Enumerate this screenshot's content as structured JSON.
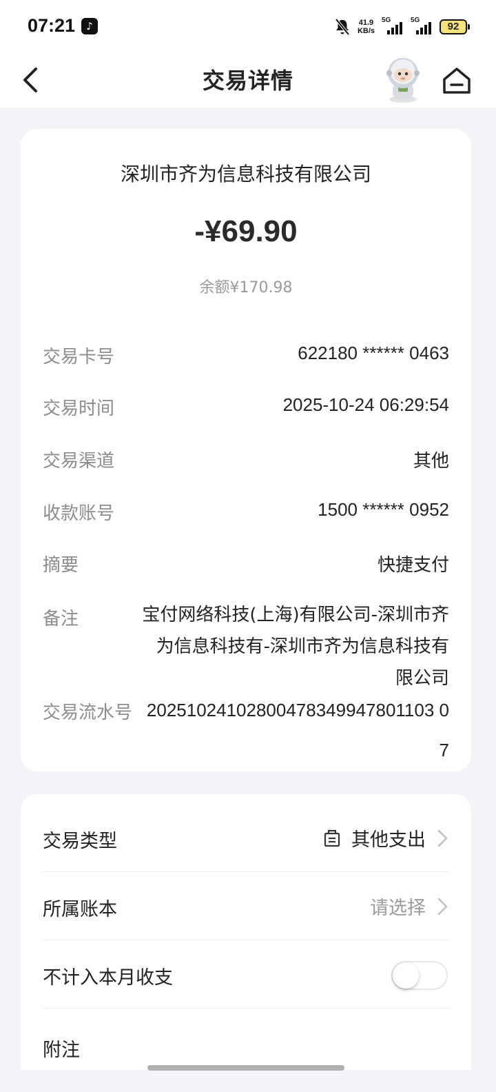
{
  "status_bar": {
    "time": "07:21",
    "net_speed_value": "41.9",
    "net_speed_unit": "KB/s",
    "signal1_label": "5G",
    "signal2_label": "5G",
    "battery": "92"
  },
  "nav": {
    "title": "交易详情",
    "back_icon": "chevron-left-icon",
    "home_icon": "home-icon"
  },
  "summary": {
    "merchant": "深圳市齐为信息科技有限公司",
    "amount": "-¥69.90",
    "balance": "余额¥170.98"
  },
  "details": {
    "card_no_label": "交易卡号",
    "card_no": "622180 ****** 0463",
    "time_label": "交易时间",
    "time": "2025-10-24 06:29:54",
    "channel_label": "交易渠道",
    "channel": "其他",
    "payee_label": "收款账号",
    "payee": "1500 ****** 0952",
    "abstract_label": "摘要",
    "abstract": "快捷支付",
    "remark_label": "备注",
    "remark": "宝付网络科技(上海)有限公司-深圳市齐为信息科技有-深圳市齐为信息科技有限公司",
    "serial_label": "交易流水号",
    "serial": "20251024102800478349947801103 07"
  },
  "settings": {
    "type_label": "交易类型",
    "type_value": "其他支出",
    "book_label": "所属账本",
    "book_placeholder": "请选择",
    "exclude_label": "不计入本月收支",
    "exclude_on": false,
    "note_label": "附注"
  }
}
